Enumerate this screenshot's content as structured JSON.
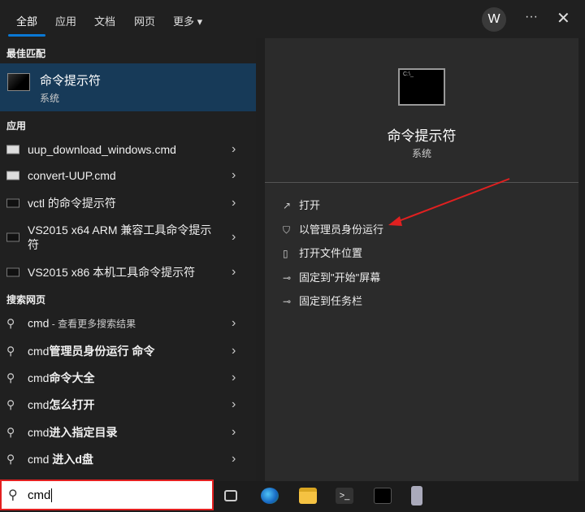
{
  "tabs": [
    "全部",
    "应用",
    "文档",
    "网页",
    "更多 ▾"
  ],
  "avatar": "W",
  "more": "···",
  "close": "✕",
  "best_match": {
    "header": "最佳匹配",
    "title": "命令提示符",
    "subtitle": "系统"
  },
  "apps": {
    "header": "应用",
    "items": [
      {
        "label": "uup_download_windows.cmd",
        "icon": "file-icon"
      },
      {
        "label": "convert-UUP.cmd",
        "icon": "file-icon"
      },
      {
        "label": "vctl 的命令提示符",
        "icon": "cmd-icon"
      },
      {
        "label": "VS2015 x64 ARM 兼容工具命令提示符",
        "icon": "cmd-icon"
      },
      {
        "label": "VS2015 x86 本机工具命令提示符",
        "icon": "cmd-icon"
      }
    ]
  },
  "web": {
    "header": "搜索网页",
    "first": {
      "query": "cmd",
      "suffix": " - 查看更多搜索结果"
    },
    "items": [
      {
        "prefix": "cmd",
        "bold": "管理员身份运行 命令"
      },
      {
        "prefix": "cmd",
        "bold": "命令大全"
      },
      {
        "prefix": "cmd",
        "bold": "怎么打开"
      },
      {
        "prefix": "cmd",
        "bold": "进入指定目录"
      },
      {
        "prefix": "cmd ",
        "bold": "进入d盘"
      }
    ]
  },
  "detail": {
    "title": "命令提示符",
    "subtitle": "系统",
    "actions": [
      {
        "label": "打开",
        "icon": "open-icon"
      },
      {
        "label": "以管理员身份运行",
        "icon": "shield-icon"
      },
      {
        "label": "打开文件位置",
        "icon": "folder-icon"
      },
      {
        "label": "固定到\"开始\"屏幕",
        "icon": "pin-icon"
      },
      {
        "label": "固定到任务栏",
        "icon": "pin-icon"
      }
    ]
  },
  "search": {
    "value": "cmd"
  },
  "taskbar": [
    "task-view",
    "edge",
    "file-explorer",
    "terminal",
    "app",
    "app2"
  ]
}
